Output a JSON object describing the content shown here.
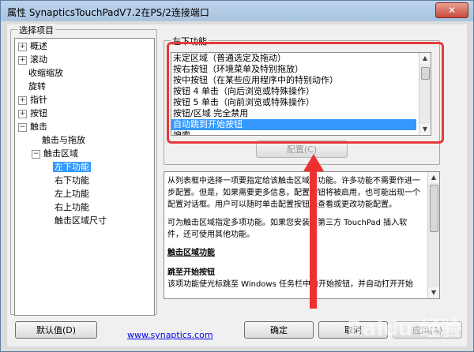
{
  "window": {
    "title": "属性 SynapticsTouchPadV7.2在PS/2连接端口",
    "close_glyph": "✕"
  },
  "tree": {
    "group_label": "选择项目",
    "items": [
      {
        "label": "概述",
        "expander": "+"
      },
      {
        "label": "滚动",
        "expander": "+"
      },
      {
        "label": "收缩缩放",
        "expander": ""
      },
      {
        "label": "旋转",
        "expander": ""
      },
      {
        "label": "指针",
        "expander": "+"
      },
      {
        "label": "按钮",
        "expander": "+"
      },
      {
        "label": "触击",
        "expander": "−"
      },
      {
        "label": "触击与拖放",
        "expander": ""
      },
      {
        "label": "触击区域",
        "expander": "−"
      },
      {
        "label": "左下功能",
        "expander": "",
        "selected": true
      },
      {
        "label": "右下功能",
        "expander": ""
      },
      {
        "label": "左上功能",
        "expander": ""
      },
      {
        "label": "右上功能",
        "expander": ""
      },
      {
        "label": "触击区域尺寸",
        "expander": ""
      }
    ]
  },
  "function": {
    "group_label": "左下功能",
    "options": [
      "未定区域（普通选定及拖动）",
      "按右按钮（环境菜单及特别拖放）",
      "按中按钮（在某些应用程序中的特别动作）",
      "按钮 4 单击（向后浏览或特殊操作）",
      "按钮 5 单击（向前浏览或特殊操作）",
      "按钮/区域 完全禁用",
      "自动跳到开始按钮",
      "搜索"
    ],
    "selected_option": "自动跳到开始按钮",
    "configure_label": "配置(C)"
  },
  "description": {
    "paragraph1": "从列表框中选择一项要指定给该触击区域的功能。许多功能不需要作进一步配置。但是，如果需要更多信息，配置按钮将被启用，也可能出现一个配置对话框。用户可以随时单击配置按钮来查看或更改功能配置。",
    "paragraph2": "可为触击区域指定多项功能。如果您安装了第三方 TouchPad 插入软件，还可使用其他功能。",
    "heading": "触击区域功能",
    "subheading": "跳至开始按钮",
    "paragraph3": "该项功能使光标跳至 Windows 任务栏中的开始按钮，并自动打开开始"
  },
  "footer": {
    "defaults_label": "默认值(D)",
    "link_text": "www.synaptics.com",
    "ok_label": "确定",
    "cancel_label": "取消",
    "apply_label": "应用(A)"
  },
  "overlay": {
    "annotation_color": "#ee3030",
    "watermark_text": "Baidu 经验"
  }
}
